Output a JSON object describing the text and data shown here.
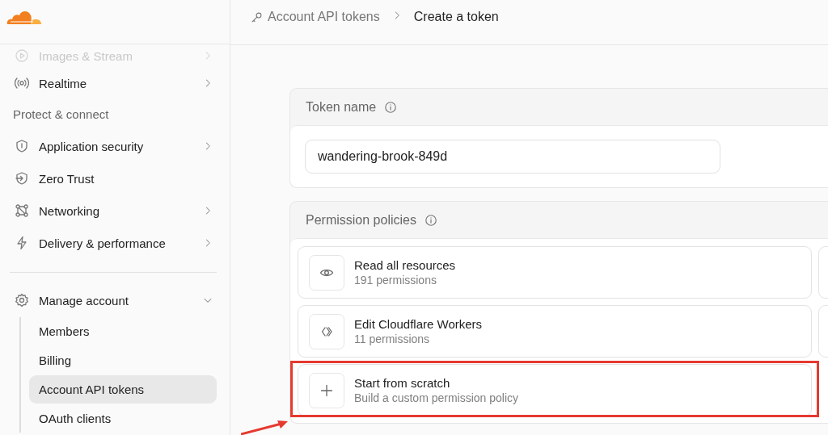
{
  "sidebar": {
    "items": [
      {
        "kind": "item",
        "label": "Images & Stream",
        "expandable": true,
        "faded": true
      },
      {
        "kind": "item",
        "label": "Realtime",
        "expandable": true,
        "faded": false
      },
      {
        "kind": "section",
        "label": "Protect & connect"
      },
      {
        "kind": "item",
        "label": "Application security",
        "expandable": true,
        "faded": false
      },
      {
        "kind": "item",
        "label": "Zero Trust",
        "expandable": false,
        "faded": false
      },
      {
        "kind": "item",
        "label": "Networking",
        "expandable": true,
        "faded": false
      },
      {
        "kind": "item",
        "label": "Delivery & performance",
        "expandable": true,
        "faded": false
      },
      {
        "kind": "divider"
      },
      {
        "kind": "item",
        "label": "Manage account",
        "expandable": true,
        "expanded": true,
        "faded": false,
        "children": [
          {
            "label": "Members",
            "selected": false
          },
          {
            "label": "Billing",
            "selected": false
          },
          {
            "label": "Account API tokens",
            "selected": true
          },
          {
            "label": "OAuth clients",
            "selected": false
          }
        ]
      }
    ]
  },
  "breadcrumb": [
    {
      "label": "Account API tokens",
      "current": false
    },
    {
      "label": "Create a token",
      "current": true
    }
  ],
  "token_name": {
    "title": "Token name",
    "value": "wandering-brook-849d"
  },
  "permission_policies": {
    "title": "Permission policies",
    "policies": [
      {
        "title": "Read all resources",
        "subtitle": "191 permissions",
        "highlighted": false
      },
      {
        "title": "Edit Cloudflare Workers",
        "subtitle": "11 permissions",
        "highlighted": false
      },
      {
        "title": "Start from scratch",
        "subtitle": "Build a custom permission policy",
        "highlighted": true
      }
    ]
  }
}
